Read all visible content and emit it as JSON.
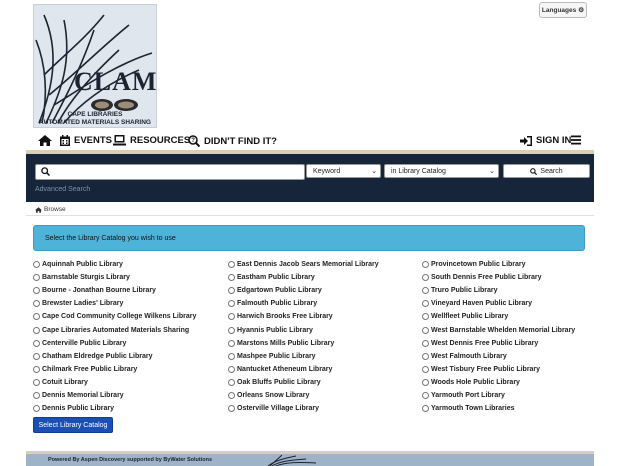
{
  "logo": {
    "name": "CLAMS",
    "line1": "CAPE LIBRARIES",
    "line2": "AUTOMATED MATERIALS SHARING"
  },
  "header": {
    "languages_label": "Languages"
  },
  "nav": {
    "events": "EVENTS",
    "resources": "RESOURCES",
    "didnt_find": "DIDN'T FIND IT?",
    "sign_in": "SIGN IN"
  },
  "search": {
    "input_value": "",
    "type_selected": "Keyword",
    "scope_selected": "in Library Catalog",
    "button_label": "Search",
    "advanced_label": "Advanced Search"
  },
  "breadcrumb": {
    "browse_label": "Browse"
  },
  "selector": {
    "prompt": "Select the Library Catalog you wish to use",
    "columns": [
      [
        "Aquinnah Public Library",
        "Barnstable Sturgis Library",
        "Bourne - Jonathan Bourne Library",
        "Brewster Ladies' Library",
        "Cape Cod Community College Wilkens Library",
        "Cape Libraries Automated Materials Sharing",
        "Centerville Public Library",
        "Chatham Eldredge Public Library",
        "Chilmark Free Public Library",
        "Cotuit Library",
        "Dennis Memorial Library",
        "Dennis Public Library"
      ],
      [
        "East Dennis Jacob Sears Memorial Library",
        "Eastham Public Library",
        "Edgartown Public Library",
        "Falmouth Public Library",
        "Harwich Brooks Free Library",
        "Hyannis Public Library",
        "Marstons Mills Public Library",
        "Mashpee Public Library",
        "Nantucket Atheneum Library",
        "Oak Bluffs Public Library",
        "Orleans Snow Library",
        "Osterville Village Library"
      ],
      [
        "Provincetown Public Library",
        "South Dennis Free Public Library",
        "Truro Public Library",
        "Vineyard Haven Public Library",
        "Wellfleet Public Library",
        "West Barnstable Whelden Memorial Library",
        "West Dennis Free Public Library",
        "West Falmouth Library",
        "West Tisbury Free Public Library",
        "Woods Hole Public Library",
        "Yarmouth Port Library",
        "Yarmouth Town Libraries"
      ]
    ],
    "submit_label": "Select Library Catalog"
  },
  "footer": {
    "text": "Powered By Aspen Discovery supported by ByWater Solutions"
  }
}
